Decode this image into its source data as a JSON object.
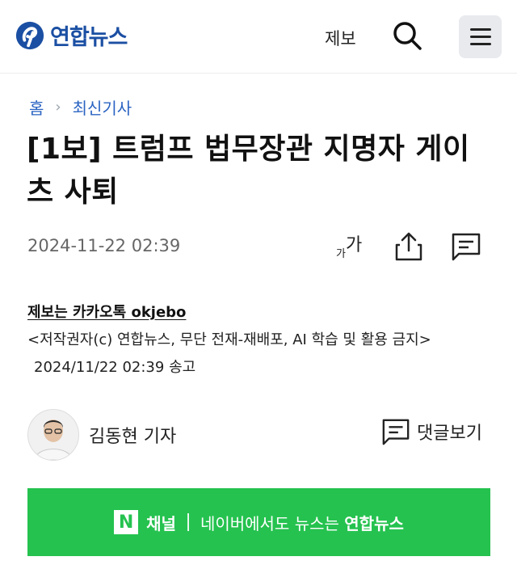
{
  "header": {
    "logo_text": "연합뉴스",
    "jebo_label": "제보",
    "brand_color": "#1b4fa3"
  },
  "breadcrumb": {
    "home": "홈",
    "section": "최신기사"
  },
  "article": {
    "title": "[1보] 트럼프 법무장관 지명자 게이츠 사퇴",
    "date": "2024-11-22 02:39",
    "fontsize_small": "가",
    "fontsize_big": "가",
    "tip_line": "제보는 카카오톡 okjebo",
    "copyright": "<저작권자(c) 연합뉴스, 무단 전재-재배포, AI 학습 및 활용 금지>",
    "sent": "2024/11/22 02:39 송고"
  },
  "byline": {
    "reporter": "김동현 기자",
    "replies_label": "댓글보기"
  },
  "naver_banner": {
    "n_letter": "N",
    "channel": "채널",
    "message_pre": "네이버에서도 뉴스는 ",
    "message_brand": "연합뉴스",
    "color": "#25c24f"
  }
}
